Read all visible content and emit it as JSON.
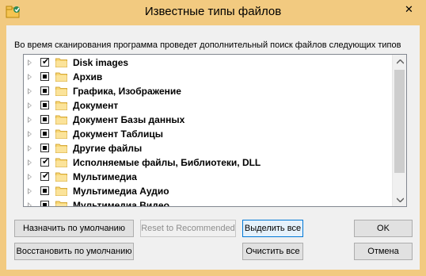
{
  "window": {
    "title": "Известные типы файлов",
    "close_symbol": "✕",
    "accent_color": "#f2ca80"
  },
  "description": "Во время сканирования программа проведет дополнительный поиск файлов следующих типов",
  "tree": {
    "items": [
      {
        "label": "Disk images",
        "state": "checked"
      },
      {
        "label": "Архив",
        "state": "indeterminate"
      },
      {
        "label": "Графика, Изображение",
        "state": "indeterminate"
      },
      {
        "label": "Документ",
        "state": "indeterminate"
      },
      {
        "label": "Документ Базы данных",
        "state": "indeterminate"
      },
      {
        "label": "Документ Таблицы",
        "state": "indeterminate"
      },
      {
        "label": "Другие файлы",
        "state": "indeterminate"
      },
      {
        "label": "Исполняемые файлы, Библиотеки, DLL",
        "state": "checked"
      },
      {
        "label": "Мультимедиа",
        "state": "checked"
      },
      {
        "label": "Мультимедиа Аудио",
        "state": "indeterminate"
      },
      {
        "label": "Мультимедиа Видео",
        "state": "indeterminate"
      }
    ],
    "checkmark": "✔"
  },
  "buttons": {
    "set_default": "Назначить по умолчанию",
    "reset_recommended": "Reset to Recommended",
    "select_all": "Выделить все",
    "ok": "OK",
    "restore_default": "Восстановить по умолчанию",
    "clear_all": "Очистить все",
    "cancel": "Отмена"
  }
}
